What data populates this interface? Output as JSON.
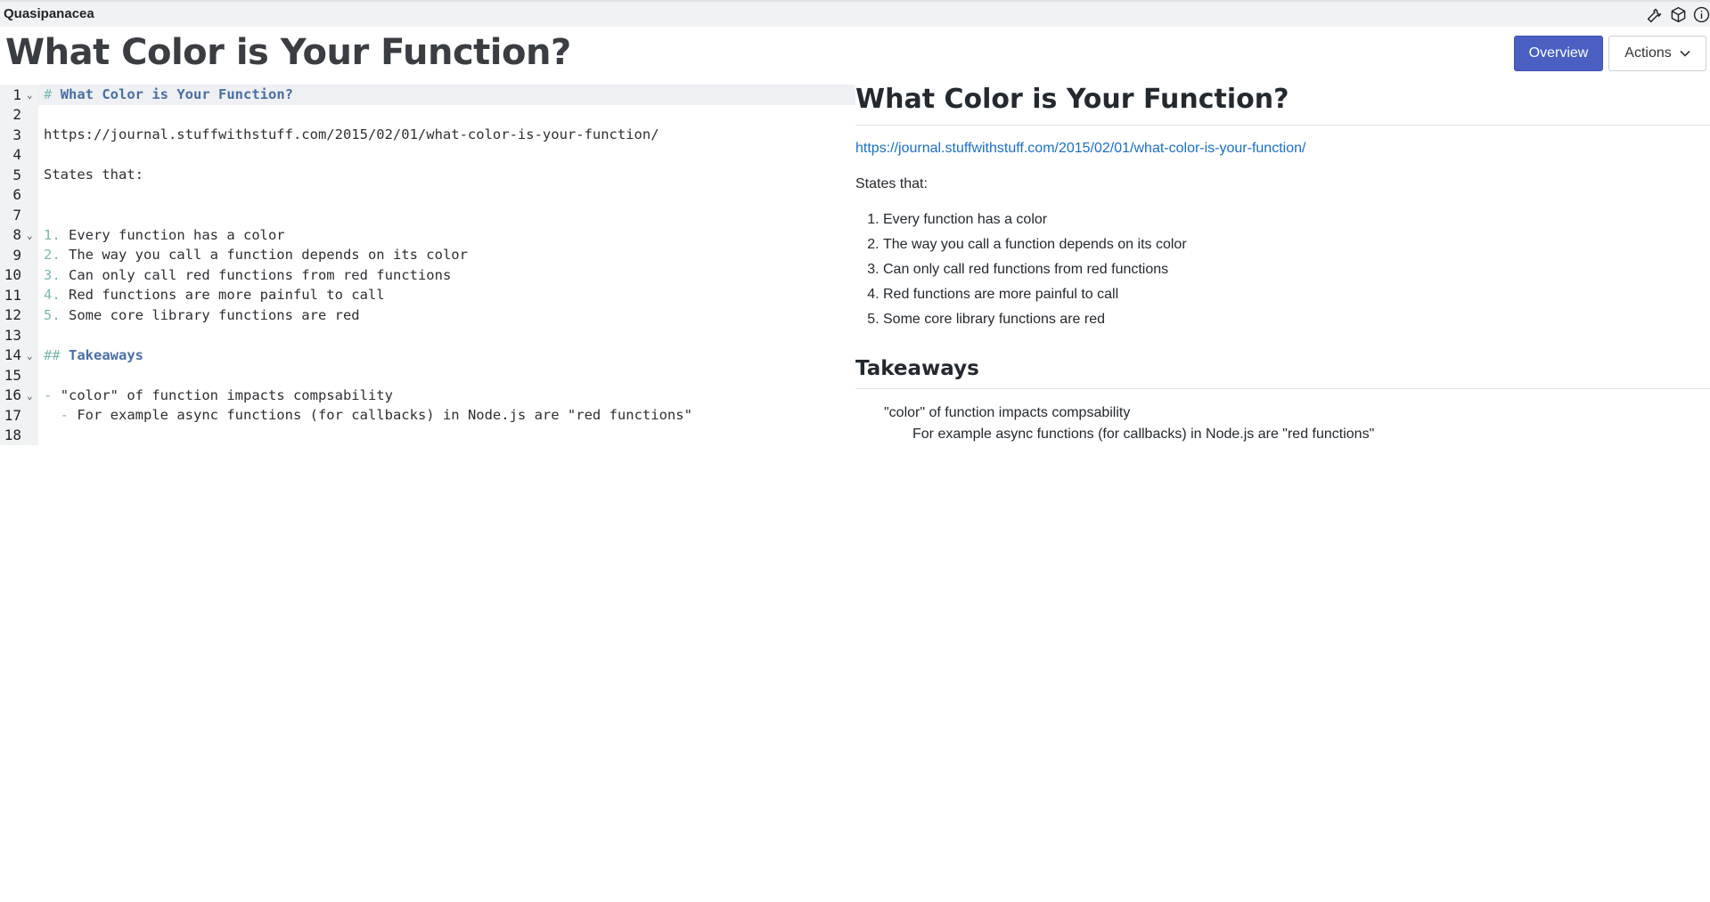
{
  "app": {
    "name": "Quasipanacea"
  },
  "toolbar": {
    "icons": [
      "wrench-icon",
      "cube-icon",
      "info-icon"
    ]
  },
  "page": {
    "title": "What Color is Your Function?"
  },
  "buttons": {
    "overview": "Overview",
    "actions": "Actions"
  },
  "editor": {
    "line_numbers": [
      "1",
      "2",
      "3",
      "4",
      "5",
      "6",
      "7",
      "8",
      "9",
      "10",
      "11",
      "12",
      "13",
      "14",
      "15",
      "16",
      "17",
      "18"
    ],
    "h1_mark": "#",
    "h1_text": "What Color is Your Function?",
    "url": "https://journal.stuffwithstuff.com/2015/02/01/what-color-is-your-function/",
    "states": "States that:",
    "list_marks": [
      "1.",
      "2.",
      "3.",
      "4.",
      "5."
    ],
    "list_items": [
      "Every function has a color",
      "The way you call a function depends on its color",
      "Can only call red functions from red functions",
      "Red functions are more painful to call",
      "Some core library functions are red"
    ],
    "h2_mark": "##",
    "h2_text": "Takeaways",
    "bullet_mark": "-",
    "bullet1": "\"color\" of function impacts compsability",
    "bullet2_mark": "  -",
    "bullet2": "For example async functions (for callbacks) in Node.js are \"red functions\""
  },
  "preview": {
    "h1": "What Color is Your Function?",
    "link": "https://journal.stuffwithstuff.com/2015/02/01/what-color-is-your-function/",
    "states": "States that:",
    "list_items": [
      "Every function has a color",
      "The way you call a function depends on its color",
      "Can only call red functions from red functions",
      "Red functions are more painful to call",
      "Some core library functions are red"
    ],
    "h2": "Takeaways",
    "bullet1": "\"color\" of function impacts compsability",
    "bullet2": "For example async functions (for callbacks) in Node.js are \"red functions\""
  }
}
